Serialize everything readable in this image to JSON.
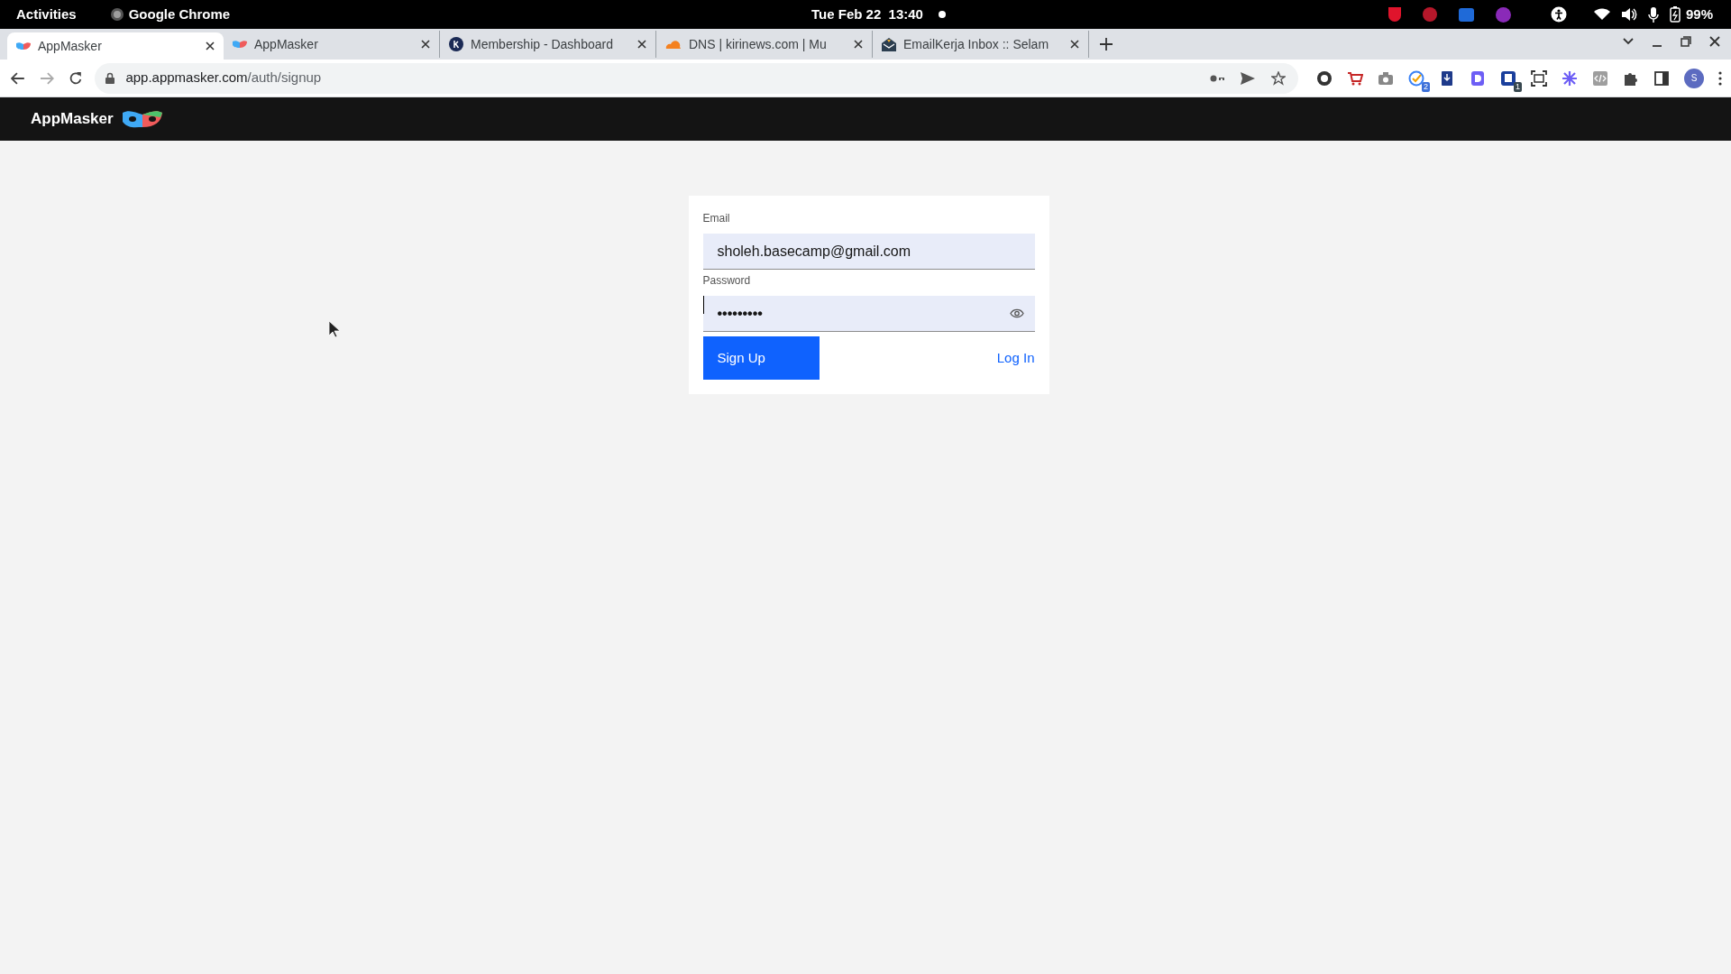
{
  "system_bar": {
    "activities": "Activities",
    "app": "Google Chrome",
    "clock": "Tue Feb 22  13:40",
    "battery": "99%"
  },
  "tabs": [
    {
      "title": "AppMasker",
      "selected": true,
      "kind": "mask"
    },
    {
      "title": "AppMasker",
      "selected": false,
      "kind": "mask"
    },
    {
      "title": "Membership - Dashboard",
      "selected": false,
      "kind": "k"
    },
    {
      "title": "DNS | kirinews.com | Mu",
      "selected": false,
      "kind": "cloud"
    },
    {
      "title": "EmailKerja Inbox :: Selam",
      "selected": false,
      "kind": "mail"
    }
  ],
  "address_bar": {
    "host": "app.appmasker.com",
    "path": "/auth/signup"
  },
  "extension_badges": [
    "2",
    "1"
  ],
  "profile_initial": "S",
  "app_header": {
    "brand": "AppMasker"
  },
  "form": {
    "email_label": "Email",
    "email_value": "sholeh.basecamp@gmail.com",
    "password_label": "Password",
    "password_value": "•••••••••",
    "password_focused": true,
    "submit": "Sign Up",
    "login_link": "Log In"
  }
}
